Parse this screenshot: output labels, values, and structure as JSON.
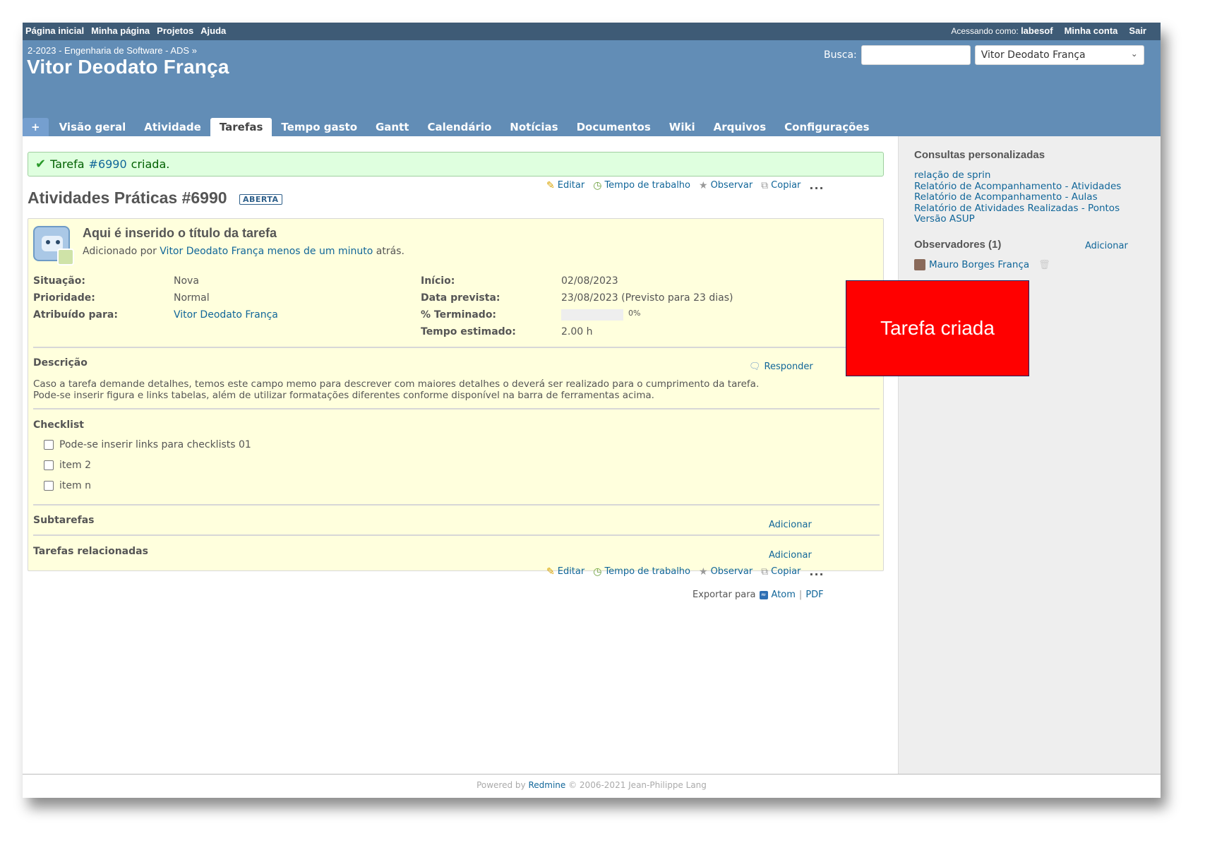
{
  "top_menu": {
    "items": [
      "Página inicial",
      "Minha página",
      "Projetos",
      "Ajuda"
    ],
    "login_prefix": "Acessando como:",
    "login_user": "labesof",
    "account": "Minha conta",
    "logout": "Sair"
  },
  "header": {
    "breadcrumb": "2-2023 - Engenharia de Software - ADS »",
    "title": "Vitor Deodato França",
    "search_label": "Busca:",
    "search_value": "",
    "jump_value": "Vitor Deodato França"
  },
  "main_menu": {
    "plus": "+",
    "tabs": [
      "Visão geral",
      "Atividade",
      "Tarefas",
      "Tempo gasto",
      "Gantt",
      "Calendário",
      "Notícias",
      "Documentos",
      "Wiki",
      "Arquivos",
      "Configurações"
    ],
    "selected": "Tarefas"
  },
  "flash": {
    "prefix": "Tarefa",
    "link": "#6990",
    "suffix": "criada."
  },
  "issue": {
    "title": "Atividades Práticas #6990",
    "status": "ABERTA",
    "actions": {
      "edit": "Editar",
      "log_time": "Tempo de trabalho",
      "watch": "Observar",
      "copy": "Copiar",
      "more": "..."
    },
    "subject": "Aqui é inserido o título da tarefa",
    "added_by_prefix": "Adicionado por",
    "author": "Vitor Deodato França",
    "added_when": "menos de um minuto",
    "added_suffix": "atrás.",
    "attributes": {
      "status_label": "Situação:",
      "status_value": "Nova",
      "priority_label": "Prioridade:",
      "priority_value": "Normal",
      "assigned_label": "Atribuído para:",
      "assigned_value": "Vitor Deodato França",
      "start_label": "Início:",
      "start_value": "02/08/2023",
      "due_label": "Data prevista:",
      "due_value": "23/08/2023 (Previsto para 23 dias)",
      "done_label": "% Terminado:",
      "done_value": "0%",
      "done_ratio": 0,
      "estimated_label": "Tempo estimado:",
      "estimated_value": "2.00 h"
    },
    "description": {
      "title": "Descrição",
      "reply": "Responder",
      "line1": "Caso a tarefa demande detalhes, temos este campo memo para descrever com maiores detalhes o deverá ser realizado para o cumprimento da tarefa.",
      "line2": "Pode-se inserir figura e links tabelas, além de utilizar formatações diferentes conforme disponível na barra de ferramentas acima."
    },
    "checklist": {
      "title": "Checklist",
      "items": [
        "Pode-se inserir links para checklists 01",
        "item 2",
        "item n"
      ]
    },
    "subtasks": {
      "title": "Subtarefas",
      "add": "Adicionar"
    },
    "relations": {
      "title": "Tarefas relacionadas",
      "add": "Adicionar"
    }
  },
  "export": {
    "label": "Exportar para",
    "atom": "Atom",
    "sep": "|",
    "pdf": "PDF"
  },
  "sidebar": {
    "queries_title": "Consultas personalizadas",
    "queries": [
      "relação de sprin",
      "Relatório de Acompanhamento - Atividades",
      "Relatório de Acompanhamento - Aulas",
      "Relatório de Atividades Realizadas - Pontos",
      "Versão ASUP"
    ],
    "watchers_title": "Observadores (1)",
    "watchers_add": "Adicionar",
    "watcher": "Mauro Borges França"
  },
  "annotation": "Tarefa criada",
  "footer": {
    "prefix": "Powered by",
    "link": "Redmine",
    "suffix": "© 2006-2021 Jean-Philippe Lang"
  },
  "colors": {
    "top_menu": "#3e5b76",
    "header": "#628db6",
    "issue_box": "#ffffdd",
    "flash": "#dfffdf",
    "annotation": "#ff0000",
    "link": "#116699"
  }
}
